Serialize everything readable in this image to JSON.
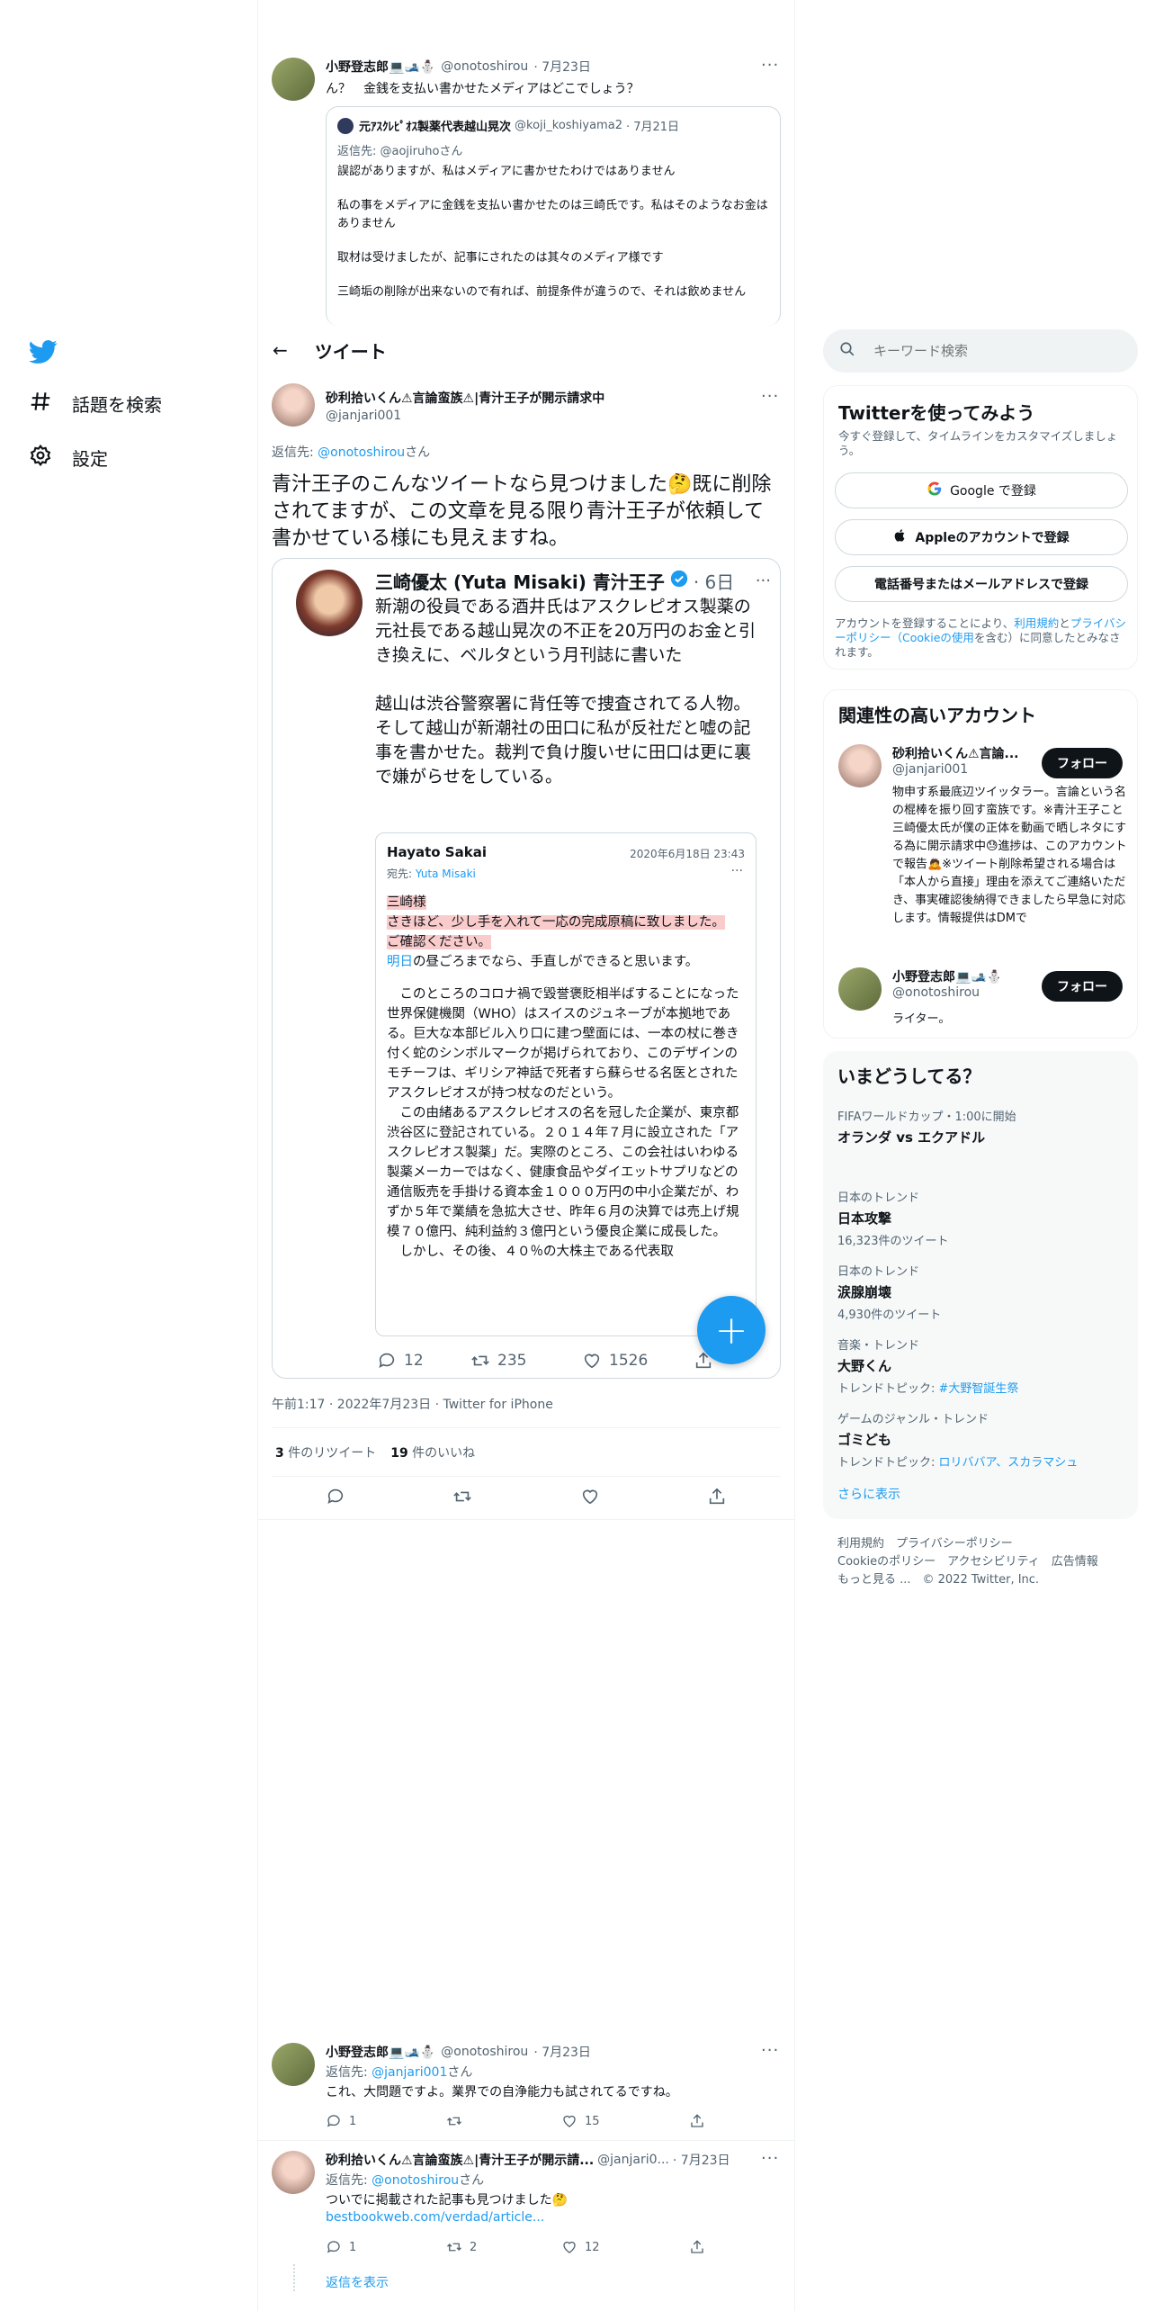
{
  "sidebar": {
    "explore_label": "話題を検索",
    "settings_label": "設定"
  },
  "top_tweet": {
    "name": "小野登志郎💻🎿⛄",
    "handle": "@onotoshirou",
    "date": "· 7月23日",
    "text": "ん？　金銭を支払い書かせたメディアはどこでしょう？",
    "quote": {
      "name": "元ｱｽｸﾚﾋﾟｵｽ製薬代表越山晃次",
      "handle": "@koji_koshiyama2",
      "date": "· 7月21日",
      "reply_to_prefix": "返信先: ",
      "reply_to": "@aojiruhoさん",
      "p1": "誤認がありますが、私はメディアに書かせたわけではありません",
      "p2": "私の事をメディアに金銭を支払い書かせたのは三崎氏です。私はそのようなお金はありません",
      "p3": "取材は受けましたが、記事にされたのは其々のメディア様です",
      "p4": "三崎垢の削除が出来ないので有れば、前提条件が違うので、それは飲めません"
    }
  },
  "header": {
    "title": "ツイート"
  },
  "main_tweet": {
    "name": "砂利拾いくん⚠言論蛮族⚠|青汁王子が開示請求中",
    "handle": "@janjari001",
    "reply_prefix": "返信先: ",
    "reply_to": "@onotoshirou",
    "reply_suffix": "さん",
    "text": "青汁王子のこんなツイートなら見つけました🤔既に削除されてますが、この文章を見る限り青汁王子が依頼して書かせている様にも見えますね。",
    "image": {
      "name": "三崎優太 (Yuta Misaki) 青汁王子",
      "date": "· 6日",
      "text1": "新潮の役員である酒井氏はアスクレピオス製薬の元社長である越山晃次の不正を20万円のお金と引き換えに、ベルタという月刊誌に書いた",
      "text2": "越山は渋谷警察署に背任等で捜査されてる人物。そして越山が新潮社の田口に私が反社だと嘘の記事を書かせた。裁判で負け腹いせに田口は更に裏で嫌がらせをしている。",
      "mail_from": "Hayato Sakai",
      "mail_date": "2020年6月18日 23:43",
      "mail_to_prefix": "宛先: ",
      "mail_to": "Yuta Misaki",
      "m1": "三崎様",
      "m2": "さきほど、少し手を入れて一応の完成原稿に致しました。",
      "m3": "ご確認ください。",
      "m4_link": "明日",
      "m4": "の昼ごろまでなら、手直しができると思います。",
      "m5": "　このところのコロナ禍で毀誉褒貶相半ばすることになった世界保健機関（WHO）はスイスのジュネーブが本拠地である。巨大な本部ビル入り口に建つ壁面には、一本の杖に巻き付く蛇のシンボルマークが掲げられており、このデザインのモチーフは、ギリシア神話で死者すら蘇らせる名医とされたアスクレピオスが持つ杖なのだという。",
      "m6": "　この由緒あるアスクレピオスの名を冠した企業が、東京都渋谷区に登記されている。２０１４年７月に設立された「アスクレピオス製薬」だ。実際のところ、この会社はいわゆる製薬メーカーではなく、健康食品やダイエットサプリなどの通信販売を手掛ける資本金１０００万円の中小企業だが、わずか５年で業績を急拡大させ、昨年６月の決算では売上げ規模７０億円、純利益約３億円という優良企業に成長した。",
      "m7": "　しかし、その後、４０％の大株主である代表取",
      "reply_count": "12",
      "retweet_count": "235",
      "like_count": "1526"
    },
    "meta": "午前1:17 · 2022年7月23日 · Twitter for iPhone",
    "retweets_num": "3",
    "retweets_label": " 件のリツイート",
    "likes_num": "19",
    "likes_label": " 件のいいね"
  },
  "replies": [
    {
      "name": "小野登志郎💻🎿⛄",
      "handle": "@onotoshirou",
      "date": "· 7月23日",
      "reply_prefix": "返信先: ",
      "reply_to": "@janjari001",
      "reply_suffix": "さん",
      "text": "これ、大問題ですよ。業界での自浄能力も試されてるですね。",
      "reply_count": "1",
      "retweet_count": "",
      "like_count": "15"
    },
    {
      "name": "砂利拾いくん⚠言論蛮族⚠|青汁王子が開示請...",
      "handle": "@janjari0...",
      "date": "· 7月23日",
      "reply_prefix": "返信先: ",
      "reply_to": "@onotoshirou",
      "reply_suffix": "さん",
      "text": "ついでに掲載された記事も見つけました🤔",
      "link": "bestbookweb.com/verdad/article...",
      "reply_count": "1",
      "retweet_count": "2",
      "like_count": "12",
      "show_replies": "返信を表示"
    }
  ],
  "search": {
    "placeholder": "キーワード検索"
  },
  "signup": {
    "title": "Twitterを使ってみよう",
    "subtitle": "今すぐ登録して、タイムラインをカスタマイズしましょう。",
    "google": "Google で登録",
    "apple": "Appleのアカウントで登録",
    "phone": "電話番号またはメールアドレスで登録",
    "legal_1": "アカウントを登録することにより、",
    "legal_terms": "利用規約",
    "legal_2": "と",
    "legal_privacy": "プライバシーポリシー（Cookieの使用",
    "legal_3": "を含む）に同意したとみなされます。"
  },
  "relevant": {
    "title": "関連性の高いアカウント",
    "accounts": [
      {
        "name": "砂利拾いくん⚠言論...",
        "handle": "@janjari001",
        "follow": "フォロー",
        "bio": "物申す系最底辺ツイッタラー。言論という名の棍棒を振り回す蛮族です。※青汁王子こと三崎優太氏が僕の正体を動画で晒しネタにする為に開示請求中😓進捗は、このアカウントで報告🙇※ツイート削除希望される場合は「本人から直接」理由を添えてご連絡いただき、事実確認後納得できましたら早急に対応します。情報提供はDMで"
      },
      {
        "name": "小野登志郎💻🎿⛄",
        "handle": "@onotoshirou",
        "follow": "フォロー",
        "bio": "ライター。"
      }
    ]
  },
  "trends": {
    "title": "いまどうしてる？",
    "items": [
      {
        "cat": "FIFAワールドカップ・1:00に開始",
        "title": "オランダ vs エクアドル",
        "count": ""
      },
      {
        "cat": "日本のトレンド",
        "title": "日本攻撃",
        "count": "16,323件のツイート"
      },
      {
        "cat": "日本のトレンド",
        "title": "涙腺崩壊",
        "count": "4,930件のツイート"
      },
      {
        "cat": "音楽・トレンド",
        "title": "大野くん",
        "count_prefix": "トレンドトピック: ",
        "count_link": "#大野智誕生祭"
      },
      {
        "cat": "ゲームのジャンル・トレンド",
        "title": "ゴミども",
        "count_prefix": "トレンドトピック: ",
        "count_link": "ロリババア、スカラマシュ"
      }
    ],
    "show_more": "さらに表示"
  },
  "footer": {
    "line1": "利用規約　プライバシーポリシー",
    "line2": "Cookieのポリシー　アクセシビリティ　広告情報",
    "line3": "もっと見る ...　© 2022 Twitter, Inc."
  },
  "colors": {
    "accent": "#1d9bf0",
    "text": "#0f1419",
    "muted": "#536471",
    "border": "#eff3f4",
    "highlight": "#f48c8c"
  }
}
